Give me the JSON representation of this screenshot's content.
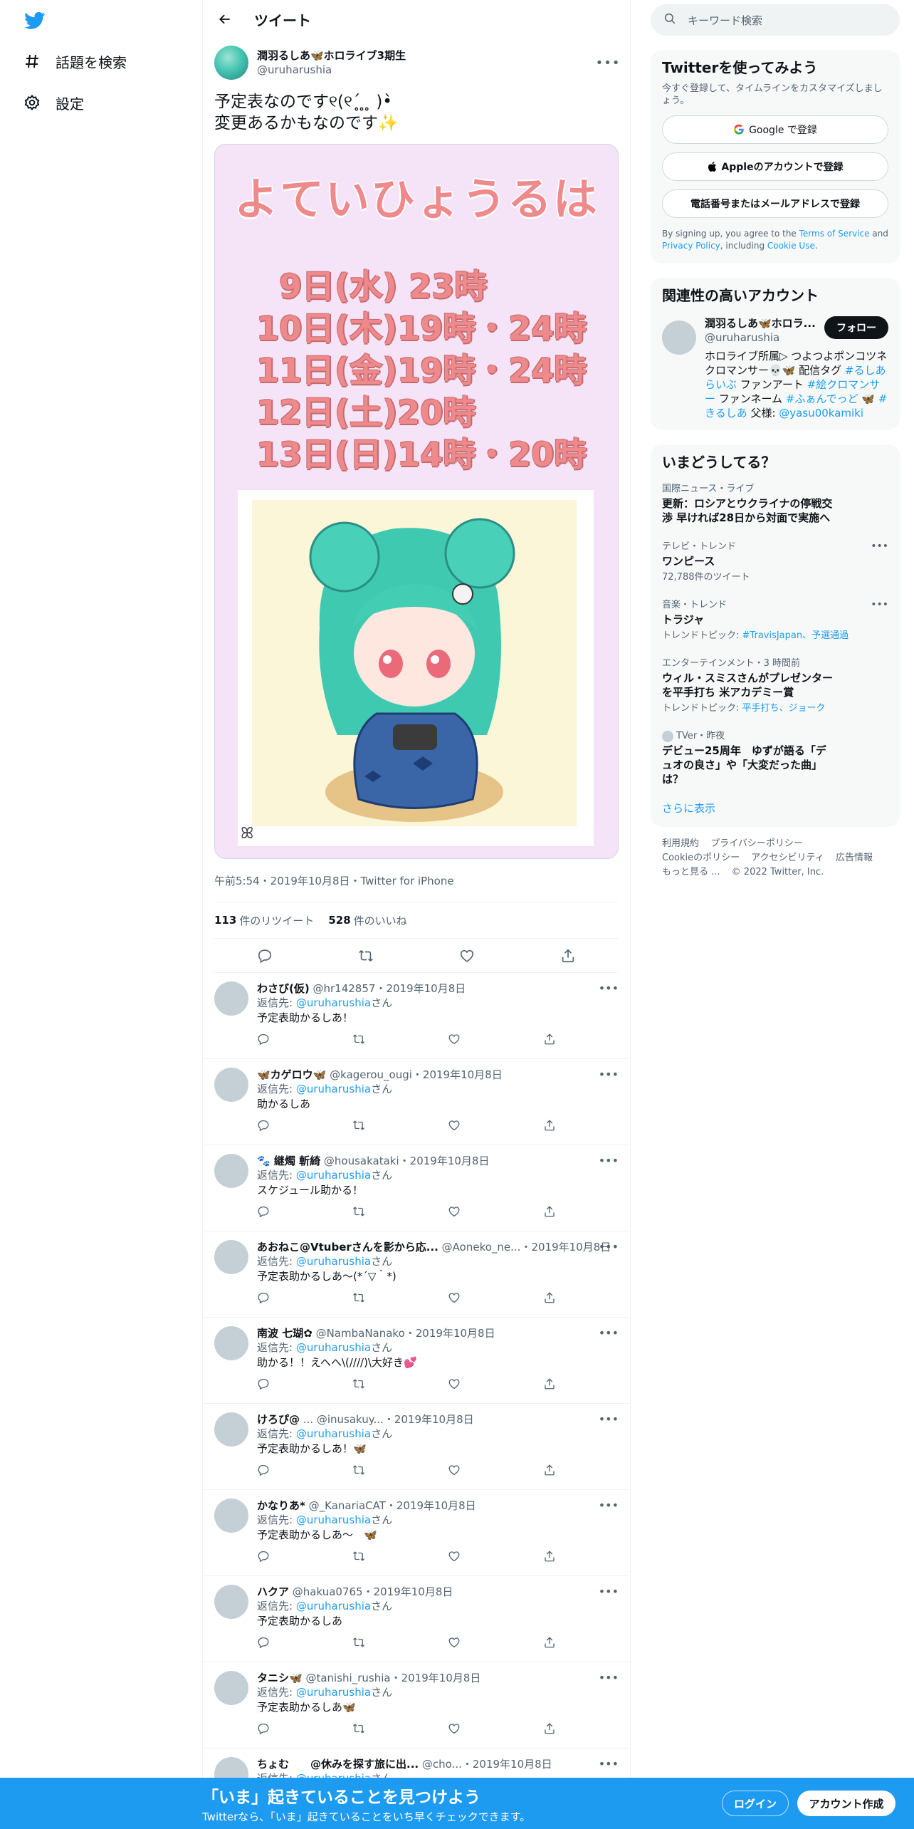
{
  "nav": {
    "explore_label": "話題を検索",
    "settings_label": "設定"
  },
  "header": {
    "title": "ツイート"
  },
  "tweet": {
    "author_name": "潤羽るしあ🦋ホロライブ3期生",
    "author_handle": "@uruharushia",
    "text": "予定表なのです୧(୧ˊ̥ ̥ ̥ )•̀\n変更あるかもなのです✨",
    "image": {
      "title": "よていひょうるは",
      "lines": [
        "9日(水) 23時",
        "10日(木)19時・24時",
        "11日(金)19時・24時",
        "12日(土)20時",
        "13日(日)14時・20時"
      ]
    },
    "meta": "午前5:54・2019年10月8日・Twitter for iPhone",
    "retweets": "113",
    "retweets_label": "件のリツイート",
    "likes": "528",
    "likes_label": "件のいいね"
  },
  "reply_to_label": "返信先: ",
  "reply_to_handle": "@uruharushia",
  "reply_to_suffix": "さん",
  "replies": [
    {
      "name": "わさび(仮)",
      "handle": "@hr142857",
      "date": "・2019年10月8日",
      "text": "予定表助かるしあ！"
    },
    {
      "name": "🦋カゲロウ🦋",
      "handle": "@kagerou_ougi",
      "date": "・2019年10月8日",
      "text": "助かるしあ"
    },
    {
      "name": "🐾 継燭 斬綺",
      "handle": "@housakataki",
      "date": "・2019年10月8日",
      "text": "スケジュール助かる！"
    },
    {
      "name": "あおねこ@Vtuberさんを影から応...",
      "handle": "@Aoneko_ne...",
      "date": "・2019年10月8日",
      "text": "予定表助かるしあ～(*´▽｀*)"
    },
    {
      "name": "南波 七瑚✿",
      "handle": "@NambaNanako",
      "date": "・2019年10月8日",
      "text": "助かる！！えへへ\\(////)\\大好き💕"
    },
    {
      "name": "けろぴ@",
      "handle": "... @inusakuy...",
      "date": "・2019年10月8日",
      "text": "予定表助かるしあ！🦋"
    },
    {
      "name": "かなりあ*",
      "handle": "@_KanariaCAT",
      "date": "・2019年10月8日",
      "text": "予定表助かるしあ～　🦋"
    },
    {
      "name": "ハクア",
      "handle": "@hakua0765",
      "date": "・2019年10月8日",
      "text": "予定表助かるしあ"
    },
    {
      "name": "タニシ🦋",
      "handle": "@tanishi_rushia",
      "date": "・2019年10月8日",
      "text": "予定表助かるしあ🦋"
    },
    {
      "name": "ちょむ　　@休みを探す旅に出...",
      "handle": "@cho...",
      "date": "・2019年10月8日",
      "text": ""
    }
  ],
  "right": {
    "search_placeholder": "キーワード検索",
    "signup_card": {
      "title": "Twitterを使ってみよう",
      "subtitle": "今すぐ登録して、タイムラインをカスタマイズしましょう。",
      "google_btn": "Google で登録",
      "apple_btn": "Appleのアカウントで登録",
      "phone_btn": "電話番号またはメールアドレスで登録",
      "legal_prefix": "By signing up, you agree to the ",
      "legal_tos": "Terms of Service",
      "legal_and": " and ",
      "legal_privacy": "Privacy Policy",
      "legal_including": ", including ",
      "legal_cookie": "Cookie Use",
      "legal_end": "."
    },
    "relevant": {
      "title": "関連性の高いアカウント",
      "name": "潤羽るしあ🦋ホロラ...",
      "handle": "@uruharushia",
      "follow": "フォロー",
      "bio_1": "ホロライブ所属▷ つよつよポンコツネクロマンサー💀🦋 配信タグ ",
      "bio_tag1": "#るしあらいぶ",
      "bio_2": " ファンアート ",
      "bio_tag2": "#絵クロマンサー",
      "bio_3": " ファンネーム ",
      "bio_tag3": "#ふぁんでっど",
      "bio_4": " 🦋 ",
      "bio_tag4": "#きるしあ",
      "bio_5": " 父様: ",
      "bio_tag5": "@yasu00kamiki"
    },
    "trends": {
      "title": "いまどうしてる？",
      "items": [
        {
          "context": "国際ニュース・ライブ",
          "title": "更新：ロシアとウクライナの停戦交渉 早ければ28日から対面で実施へ",
          "sub": ""
        },
        {
          "context": "テレビ・トレンド",
          "title": "ワンピース",
          "sub": "72,788件のツイート"
        },
        {
          "context": "音楽・トレンド",
          "title": "トラジャ",
          "sub_prefix": "トレンドトピック: ",
          "sub_links": "#TravisJapan、予選通過"
        },
        {
          "context": "エンターテインメント・3 時間前",
          "title": "ウィル・スミスさんがプレゼンターを平手打ち 米アカデミー賞",
          "sub_prefix": "トレンドトピック: ",
          "sub_links": "平手打ち、ジョーク"
        },
        {
          "context": "TVer・昨夜",
          "title": "デビュー25周年　ゆずが語る「デュオの良さ」や「大変だった曲」は？",
          "sub": ""
        }
      ],
      "show_more": "さらに表示"
    },
    "footer": {
      "links": [
        "利用規約",
        "プライバシーポリシー",
        "Cookieのポリシー",
        "アクセシビリティ",
        "広告情報",
        "もっと見る ..."
      ],
      "copyright": "© 2022 Twitter, Inc."
    }
  },
  "bottom_bar": {
    "title": "「いま」起きていることを見つけよう",
    "subtitle": "Twitterなら、「いま」起きていることをいち早くチェックできます。",
    "login": "ログイン",
    "signup": "アカウント作成"
  },
  "colors": {
    "brand_blue": "#1d9bf0",
    "text_primary": "#0f1419",
    "text_secondary": "#536471",
    "image_pink": "#ef8a8c"
  },
  "icons": [
    "twitter-logo-icon",
    "hashtag-icon",
    "gear-icon",
    "back-arrow-icon",
    "search-icon",
    "more-icon",
    "reply-icon",
    "retweet-icon",
    "like-icon",
    "share-icon",
    "google-icon",
    "apple-icon",
    "verified-icon"
  ]
}
